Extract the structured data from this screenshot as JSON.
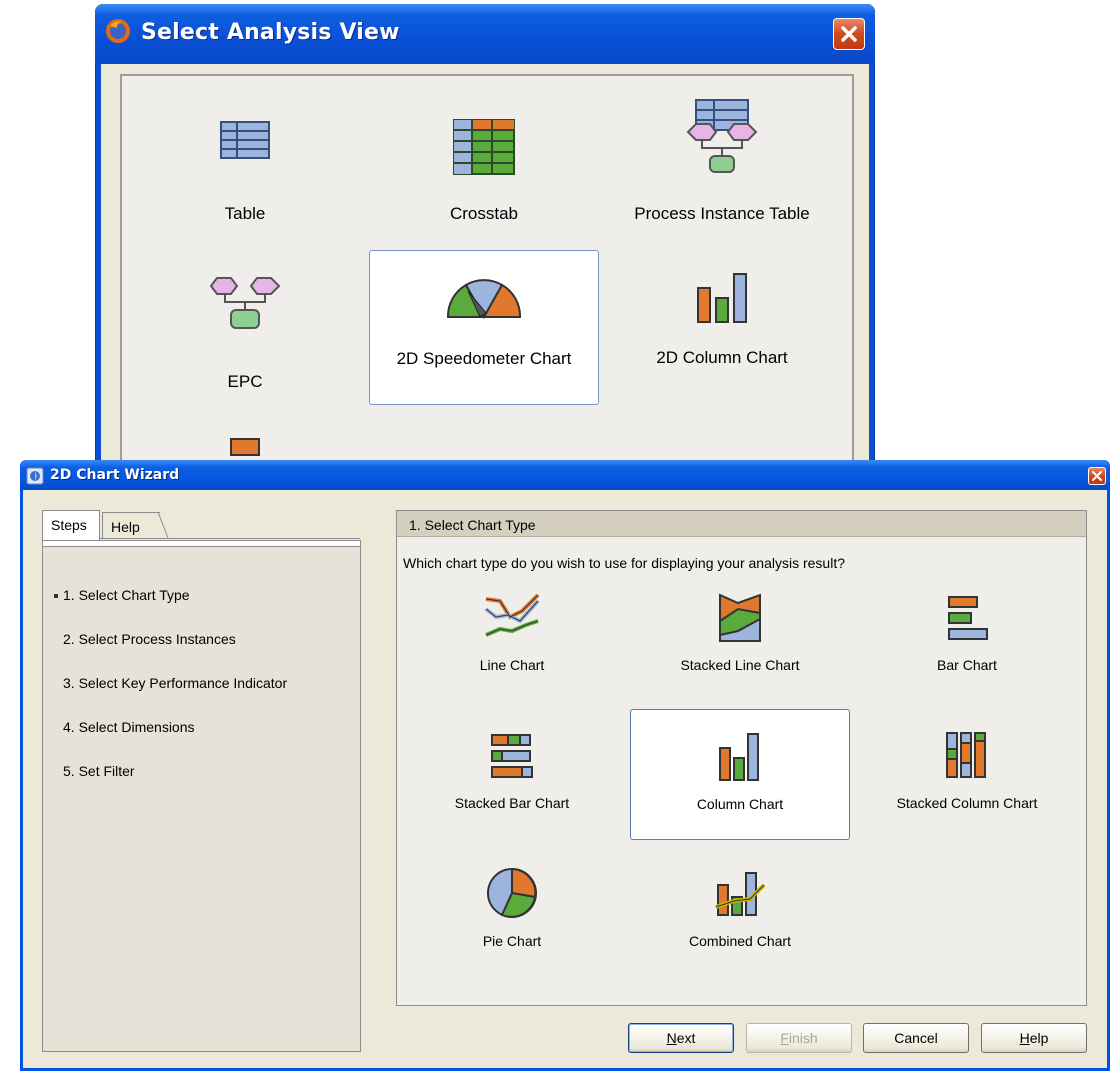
{
  "analysis_view_window": {
    "title": "Select Analysis View",
    "items": [
      {
        "label": "Table",
        "icon": "table-icon"
      },
      {
        "label": "Crosstab",
        "icon": "crosstab-icon"
      },
      {
        "label": "Process Instance Table",
        "icon": "process-instance-table-icon"
      },
      {
        "label": "EPC",
        "icon": "epc-icon"
      },
      {
        "label": "2D  Speedometer Chart",
        "icon": "speedometer-chart-icon",
        "selected": true
      },
      {
        "label": "2D  Column Chart",
        "icon": "column-chart-icon"
      }
    ]
  },
  "wizard_window": {
    "title": "2D Chart Wizard",
    "tabs": [
      {
        "label": "Steps",
        "active": true
      },
      {
        "label": "Help",
        "active": false
      }
    ],
    "steps": [
      {
        "label": "1. Select Chart Type",
        "current": true
      },
      {
        "label": "2. Select Process Instances"
      },
      {
        "label": "3. Select Key Performance Indicator"
      },
      {
        "label": "4. Select Dimensions"
      },
      {
        "label": "5. Set Filter"
      }
    ],
    "section_header": "1. Select Chart Type",
    "question": "Which chart type do you wish to use for displaying your analysis result?",
    "chart_types": [
      {
        "label": "Line Chart",
        "icon": "line-chart-icon"
      },
      {
        "label": "Stacked Line Chart",
        "icon": "stacked-line-chart-icon"
      },
      {
        "label": "Bar Chart",
        "icon": "bar-chart-icon"
      },
      {
        "label": "Stacked Bar Chart",
        "icon": "stacked-bar-chart-icon"
      },
      {
        "label": "Column Chart",
        "icon": "column-chart-icon",
        "selected": true
      },
      {
        "label": "Stacked Column Chart",
        "icon": "stacked-column-chart-icon"
      },
      {
        "label": "Pie Chart",
        "icon": "pie-chart-icon"
      },
      {
        "label": "Combined Chart",
        "icon": "combined-chart-icon"
      }
    ],
    "buttons": {
      "next": {
        "underlined": "N",
        "rest": "ext",
        "enabled": true
      },
      "finish": {
        "underlined": "F",
        "rest": "inish",
        "enabled": false
      },
      "cancel": {
        "label": "Cancel",
        "enabled": true
      },
      "help": {
        "underlined": "H",
        "rest": "elp",
        "enabled": true
      }
    }
  },
  "colors": {
    "xp_title_blue": "#0054e3",
    "close_red": "#d2491c",
    "dialog_face": "#ece9d8",
    "icon_orange": "#e0782e",
    "icon_green": "#5aaa3c",
    "icon_blue": "#9db4dc",
    "icon_pink": "#e6b4e6"
  }
}
